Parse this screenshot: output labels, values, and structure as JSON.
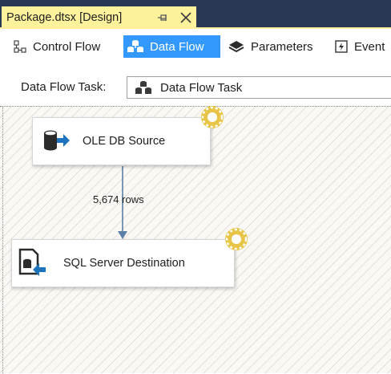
{
  "document_tab": {
    "title": "Package.dtsx [Design]",
    "pin_icon": "pin-icon",
    "close_icon": "close-icon",
    "colors": {
      "strip": "#293955",
      "active_tab": "#fff29d"
    }
  },
  "designer_tabs": [
    {
      "label": "Control Flow",
      "icon": "control-flow-icon",
      "active": false
    },
    {
      "label": "Data Flow",
      "icon": "data-flow-icon",
      "active": true
    },
    {
      "label": "Parameters",
      "icon": "parameters-icon",
      "active": false
    },
    {
      "label": "Event",
      "icon": "event-handlers-icon",
      "active": false
    }
  ],
  "task_selector": {
    "label": "Data Flow Task:",
    "value": "Data Flow Task",
    "icon": "data-flow-task-icon"
  },
  "canvas": {
    "nodes": [
      {
        "id": "source",
        "label": "OLE DB Source",
        "icon": "ole-db-source-icon"
      },
      {
        "id": "dest",
        "label": "SQL Server Destination",
        "icon": "sql-server-destination-icon"
      }
    ],
    "path_label": "5,674 rows",
    "colors": {
      "accent": "#3399ff",
      "path": "#5b7fa6",
      "gear": "#e8c547"
    }
  }
}
